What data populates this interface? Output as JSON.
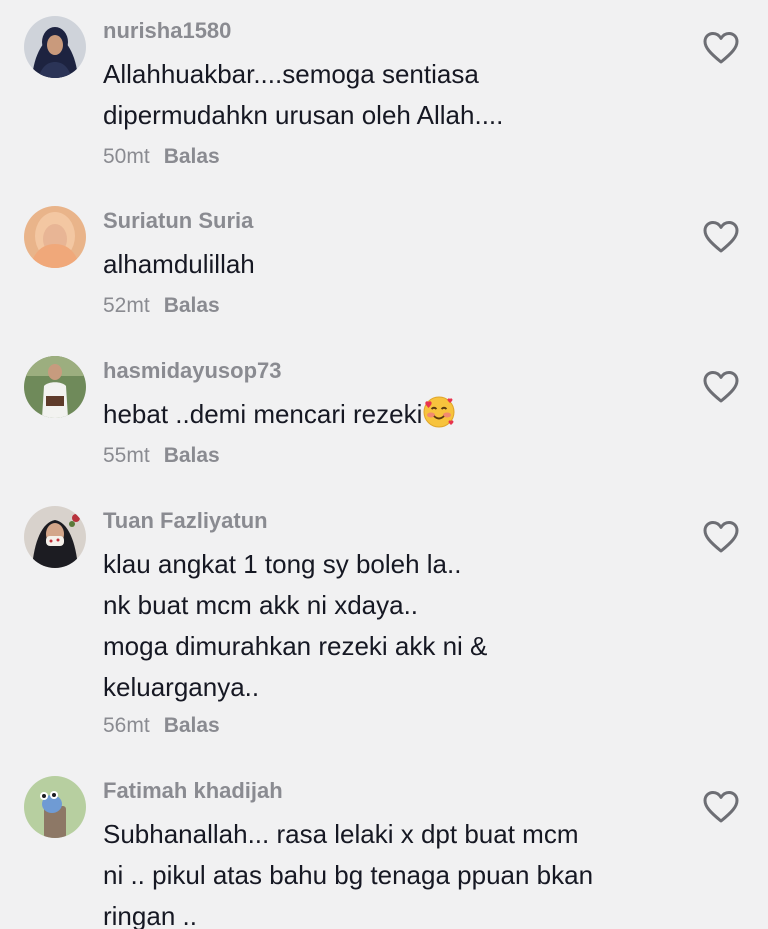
{
  "comments": [
    {
      "username": "nurisha1580",
      "lines": [
        "Allahhuakbar....semoga sentiasa",
        "dipermudahkn urusan oleh Allah...."
      ],
      "time": "50mt",
      "reply_label": "Balas"
    },
    {
      "username": "Suriatun Suria",
      "lines": [
        "alhamdulillah"
      ],
      "time": "52mt",
      "reply_label": "Balas"
    },
    {
      "username": "hasmidayusop73",
      "lines": [
        "hebat ..demi mencari rezeki"
      ],
      "emoji": "smiling-face-with-hearts-emoji",
      "time": "55mt",
      "reply_label": "Balas"
    },
    {
      "username": "Tuan Fazliyatun",
      "lines": [
        "klau angkat 1 tong sy boleh la..",
        "nk buat mcm akk ni xdaya..",
        "moga dimurahkan rezeki akk ni &",
        "keluarganya.."
      ],
      "time": "56mt",
      "reply_label": "Balas"
    },
    {
      "username": "Fatimah khadijah",
      "lines": [
        "Subhanallah... rasa lelaki x dpt buat mcm",
        "ni .. pikul atas bahu bg tenaga ppuan bkan",
        "ringan .."
      ]
    }
  ],
  "icons": {
    "like": "heart-outline-icon"
  },
  "colors": {
    "background": "#f1f1f2",
    "text": "#161823",
    "secondary": "#8a8b91"
  }
}
